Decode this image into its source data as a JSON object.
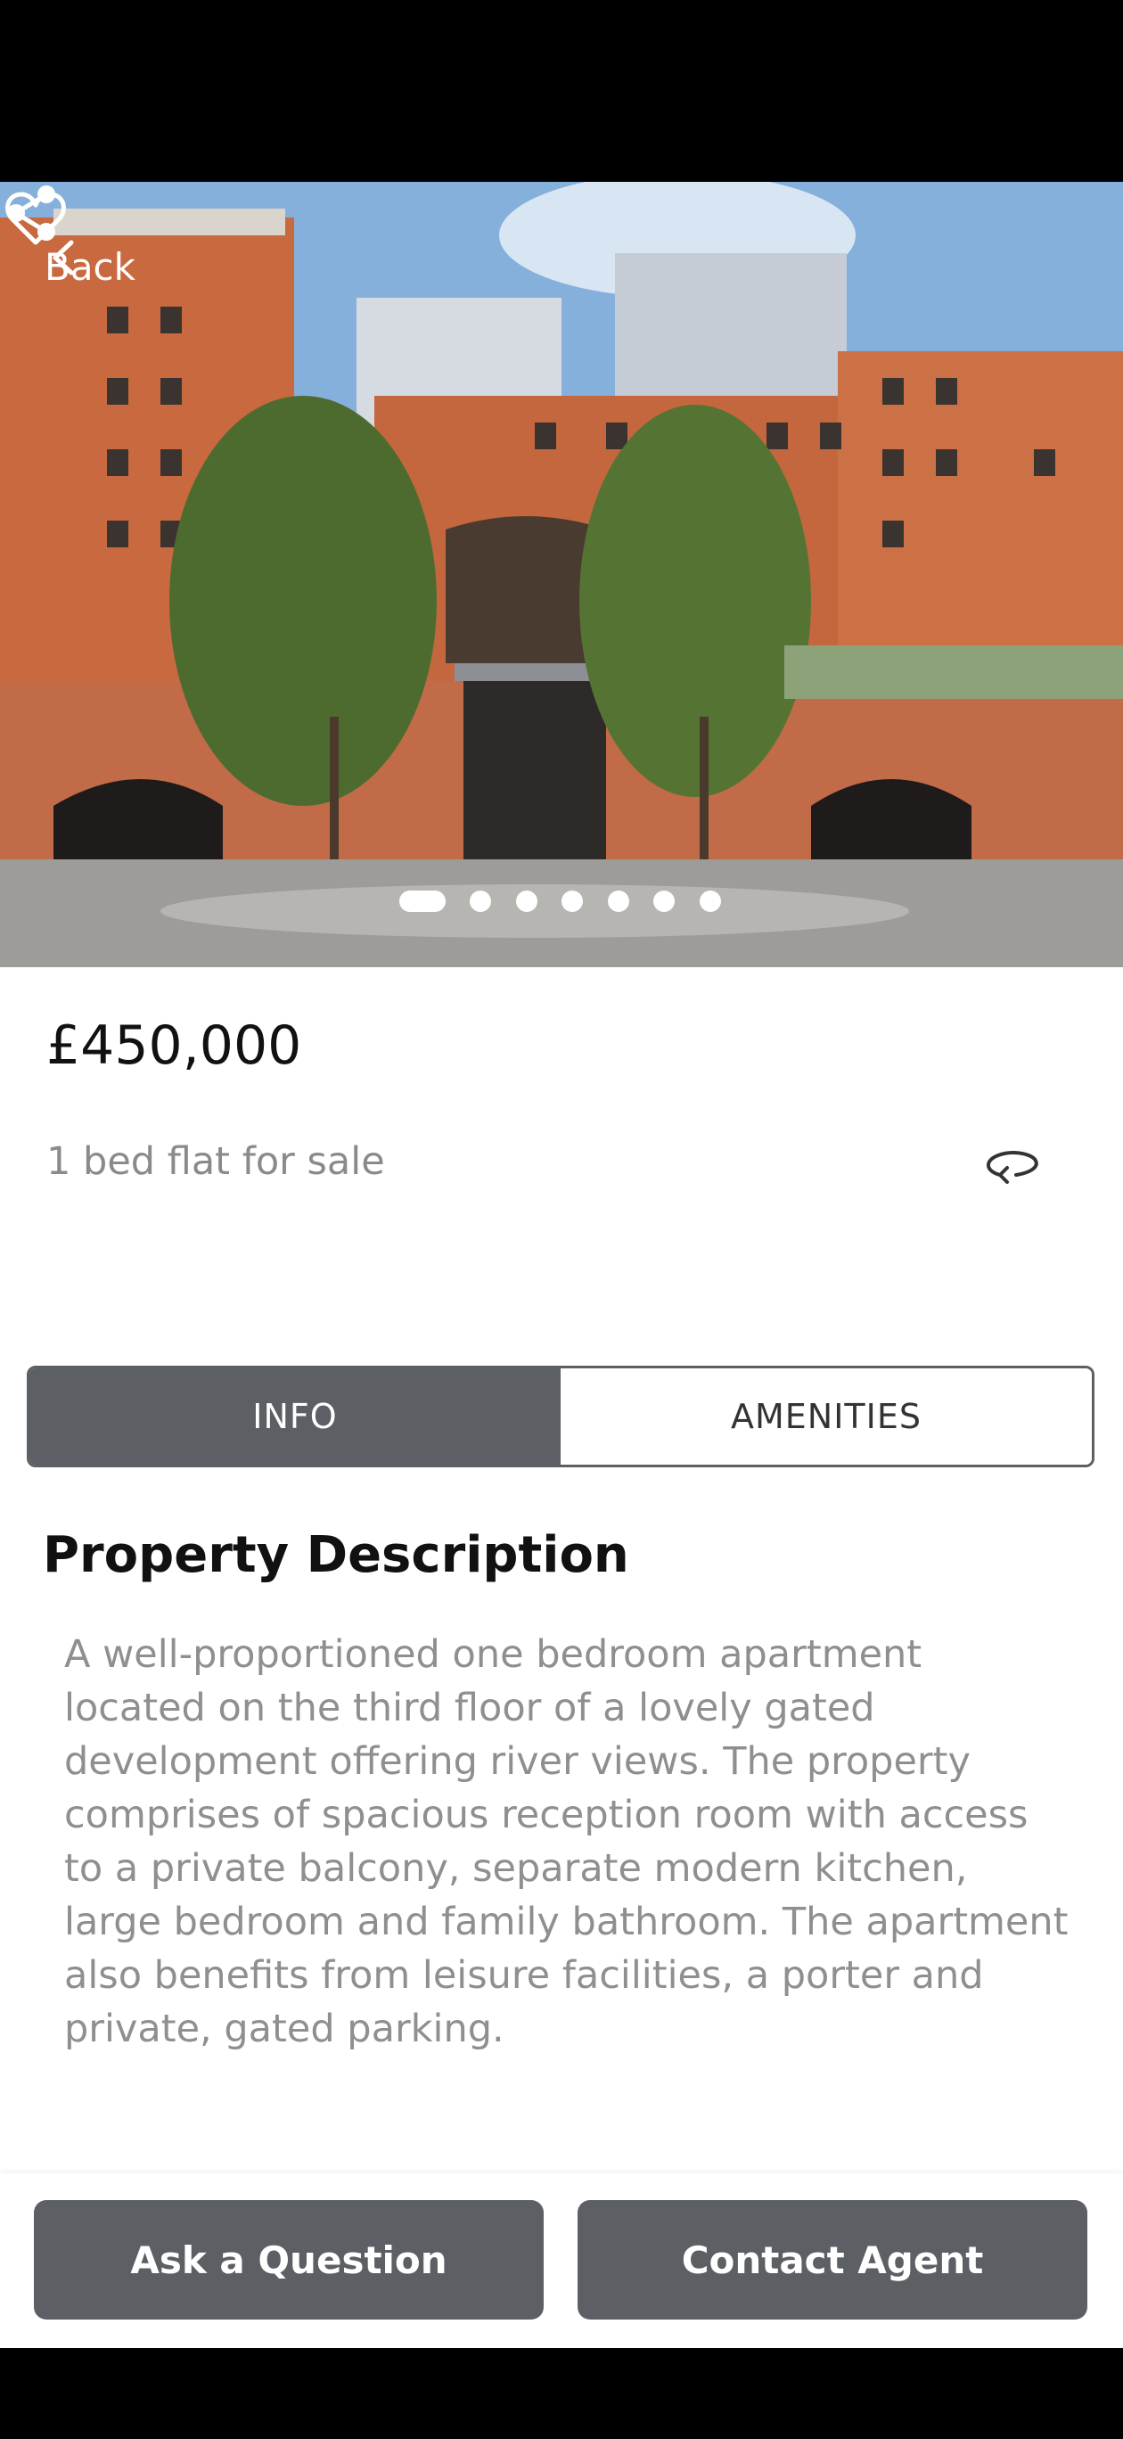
{
  "header": {
    "back_label": "Back",
    "icons": {
      "back": "chevron-left-icon",
      "share": "share-icon",
      "favorite": "heart-outline-icon"
    }
  },
  "gallery": {
    "image_count": 7,
    "current_index": 1
  },
  "listing": {
    "price": "£450,000",
    "type": "1 bed flat for sale",
    "icons": {
      "view": "rotate-360-icon"
    }
  },
  "tabs": [
    {
      "label": "INFO",
      "active": true
    },
    {
      "label": "AMENITIES",
      "active": false
    }
  ],
  "description": {
    "title": "Property Description",
    "body": "A well-proportioned one bedroom apartment located on the third floor of a lovely gated development offering river views. The property comprises of spacious reception room with access to a private balcony, separate modern kitchen, large bedroom and family bathroom. The apartment also benefits from leisure facilities, a porter and private, gated parking."
  },
  "actions": {
    "ask_label": "Ask a Question",
    "contact_label": "Contact Agent"
  },
  "colors": {
    "primary": "#5c5f63",
    "muted_text": "#8f8f8f"
  }
}
